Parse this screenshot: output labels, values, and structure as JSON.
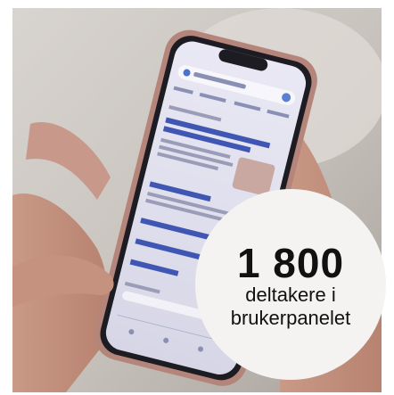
{
  "badge": {
    "number": "1 800",
    "line1": "deltakere i",
    "line2": "brukerpanelet"
  }
}
